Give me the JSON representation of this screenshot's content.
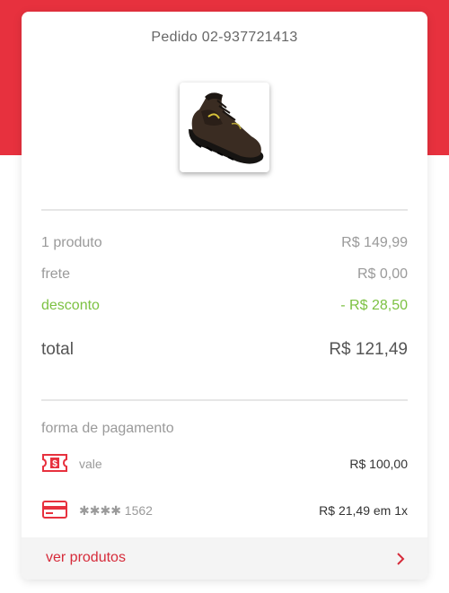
{
  "colors": {
    "accent": "#e7313e",
    "discount": "#7cc142",
    "link": "#d62b3a"
  },
  "order": {
    "title": "Pedido 02-937721413",
    "thumbnail_icon": "boot-product-image"
  },
  "summary": {
    "products_label": "1 produto",
    "products_value": "R$ 149,99",
    "shipping_label": "frete",
    "shipping_value": "R$ 0,00",
    "discount_label": "desconto",
    "discount_value": "- R$ 28,50",
    "total_label": "total",
    "total_value": "R$ 121,49"
  },
  "payment": {
    "section_label": "forma de pagamento",
    "methods": [
      {
        "icon": "voucher-icon",
        "name": "vale",
        "amount": "R$ 100,00"
      },
      {
        "icon": "credit-card-icon",
        "name": "✱✱✱✱ 1562",
        "amount": "R$ 21,49 em 1x"
      }
    ]
  },
  "footer": {
    "label": "ver produtos",
    "icon": "chevron-right-icon"
  }
}
